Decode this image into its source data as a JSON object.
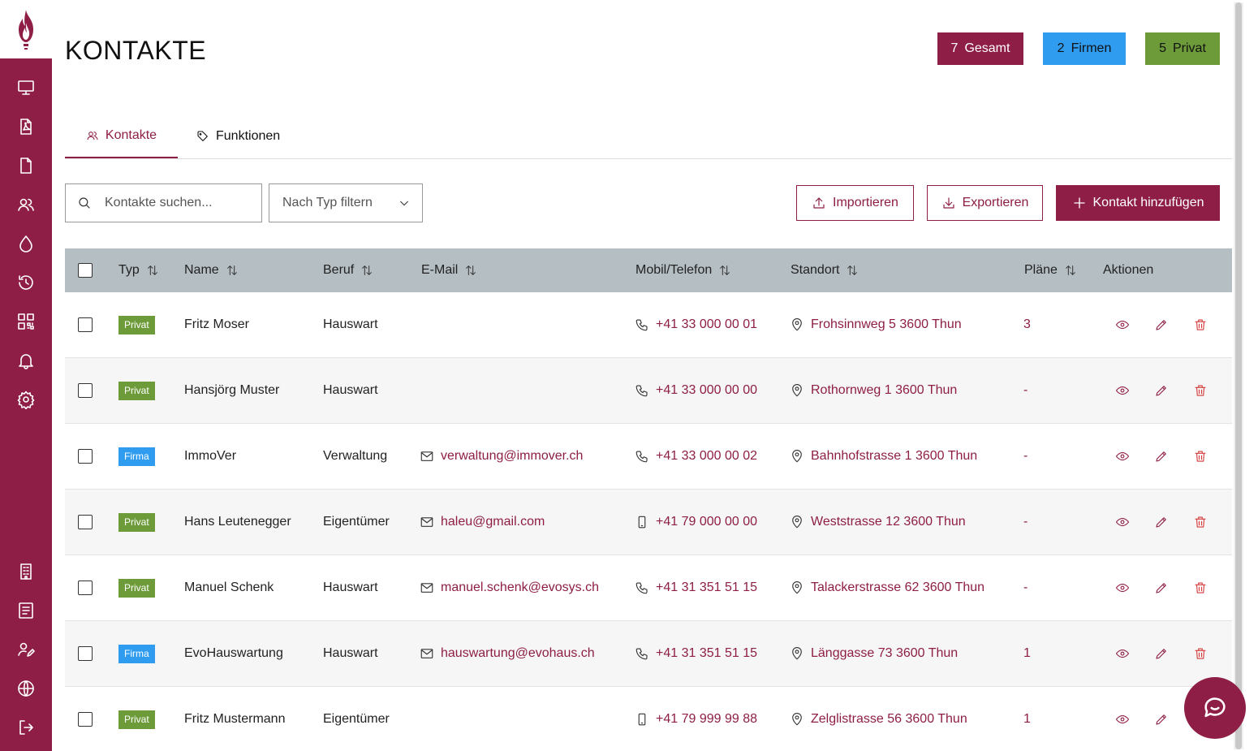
{
  "page": {
    "title": "KONTAKTE"
  },
  "stats": {
    "total_count": "7",
    "total_label": "Gesamt",
    "firms_count": "2",
    "firms_label": "Firmen",
    "private_count": "5",
    "private_label": "Privat"
  },
  "tabs": [
    {
      "label": "Kontakte",
      "icon": "users-icon",
      "active": true
    },
    {
      "label": "Funktionen",
      "icon": "tag-icon",
      "active": false
    }
  ],
  "toolbar": {
    "search_placeholder": "Kontakte suchen...",
    "filter_label": "Nach Typ filtern",
    "import_label": "Importieren",
    "export_label": "Exportieren",
    "add_label": "Kontakt hinzufügen"
  },
  "table": {
    "headers": {
      "typ": "Typ",
      "name": "Name",
      "beruf": "Beruf",
      "email": "E-Mail",
      "phone": "Mobil/Telefon",
      "location": "Standort",
      "plans": "Pläne",
      "actions": "Aktionen"
    },
    "rows": [
      {
        "type": "Privat",
        "name": "Fritz Moser",
        "job": "Hauswart",
        "email": "",
        "phone": "+41 33 000 00 01",
        "phone_kind": "phone",
        "location": "Frohsinnweg 5 3600 Thun",
        "plans": "3"
      },
      {
        "type": "Privat",
        "name": "Hansjörg Muster",
        "job": "Hauswart",
        "email": "",
        "phone": "+41 33 000 00 00",
        "phone_kind": "phone",
        "location": "Rothornweg 1 3600 Thun",
        "plans": "-"
      },
      {
        "type": "Firma",
        "name": "ImmoVer",
        "job": "Verwaltung",
        "email": "verwaltung@immover.ch",
        "phone": "+41 33 000 00 02",
        "phone_kind": "phone",
        "location": "Bahnhofstrasse 1 3600 Thun",
        "plans": "-"
      },
      {
        "type": "Privat",
        "name": "Hans Leutenegger",
        "job": "Eigentümer",
        "email": "haleu@gmail.com",
        "phone": "+41 79 000 00 00",
        "phone_kind": "mobile",
        "location": "Weststrasse 12 3600 Thun",
        "plans": "-"
      },
      {
        "type": "Privat",
        "name": "Manuel Schenk",
        "job": "Hauswart",
        "email": "manuel.schenk@evosys.ch",
        "phone": "+41 31 351 51 15",
        "phone_kind": "phone",
        "location": "Talackerstrasse 62 3600 Thun",
        "plans": "-"
      },
      {
        "type": "Firma",
        "name": "EvoHauswartung",
        "job": "Hauswart",
        "email": "hauswartung@evohaus.ch",
        "phone": "+41 31 351 51 15",
        "phone_kind": "phone",
        "location": "Länggasse 73 3600 Thun",
        "plans": "1"
      },
      {
        "type": "Privat",
        "name": "Fritz Mustermann",
        "job": "Eigentümer",
        "email": "",
        "phone": "+41 79 999 99 88",
        "phone_kind": "mobile",
        "location": "Zelglistrasse 56 3600 Thun",
        "plans": "1"
      }
    ]
  },
  "sidebar": {
    "items": [
      {
        "icon": "monitor-icon"
      },
      {
        "icon": "pdf-file-icon"
      },
      {
        "icon": "file-icon"
      },
      {
        "icon": "users-icon"
      },
      {
        "icon": "drop-icon"
      },
      {
        "icon": "history-icon"
      },
      {
        "icon": "qr-code-icon"
      },
      {
        "icon": "bell-icon"
      },
      {
        "icon": "gear-icon"
      },
      {
        "icon": "building-icon"
      },
      {
        "icon": "book-icon"
      },
      {
        "icon": "user-edit-icon"
      },
      {
        "icon": "globe-icon"
      },
      {
        "icon": "logout-icon"
      }
    ]
  },
  "colors": {
    "primary": "#8e1e45",
    "firma": "#2f9cf0",
    "privat": "#6d9b3a",
    "header_bg": "#b5bec3"
  }
}
